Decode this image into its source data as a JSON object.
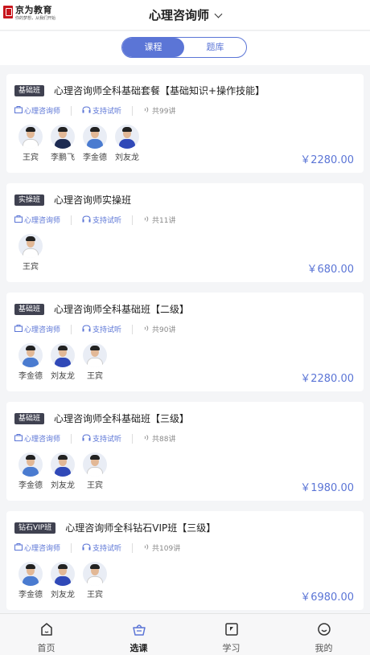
{
  "header": {
    "logo_name": "京为教育",
    "logo_slogan": "你的梦想，从我们开始",
    "title": "心理咨询师"
  },
  "segment": {
    "tabs": [
      {
        "label": "课程",
        "active": true
      },
      {
        "label": "题库",
        "active": false
      }
    ]
  },
  "courses": [
    {
      "badge": "基础班",
      "name": "心理咨询师全科基础套餐【基础知识+操作技能】",
      "category": "心理咨询师",
      "trial": "支持试听",
      "lessons": "共99讲",
      "teachers": [
        "王宾",
        "李鹏飞",
        "李金德",
        "刘友龙"
      ],
      "price": "￥2280.00"
    },
    {
      "badge": "实操班",
      "name": "心理咨询师实操班",
      "category": "心理咨询师",
      "trial": "支持试听",
      "lessons": "共11讲",
      "teachers": [
        "王宾"
      ],
      "price": "￥680.00"
    },
    {
      "badge": "基础班",
      "name": "心理咨询师全科基础班【二级】",
      "category": "心理咨询师",
      "trial": "支持试听",
      "lessons": "共90讲",
      "teachers": [
        "李金德",
        "刘友龙",
        "王宾"
      ],
      "price": "￥2280.00"
    },
    {
      "badge": "基础班",
      "name": "心理咨询师全科基础班【三级】",
      "category": "心理咨询师",
      "trial": "支持试听",
      "lessons": "共88讲",
      "teachers": [
        "李金德",
        "刘友龙",
        "王宾"
      ],
      "price": "￥1980.00"
    },
    {
      "badge": "钻石VIP班",
      "name": "心理咨询师全科钻石VIP班【三级】",
      "category": "心理咨询师",
      "trial": "支持试听",
      "lessons": "共109讲",
      "teachers": [
        "李金德",
        "刘友龙",
        "王宾"
      ],
      "price": "￥6980.00"
    }
  ],
  "tabbar": {
    "items": [
      {
        "label": "首页",
        "icon": "home-icon",
        "active": false
      },
      {
        "label": "选课",
        "icon": "basket-icon",
        "active": true
      },
      {
        "label": "学习",
        "icon": "study-icon",
        "active": false
      },
      {
        "label": "我的",
        "icon": "profile-icon",
        "active": false
      }
    ]
  },
  "colors": {
    "accent": "#5b75d6",
    "badge_bg": "#3f4150",
    "logo_red": "#c8161d"
  }
}
